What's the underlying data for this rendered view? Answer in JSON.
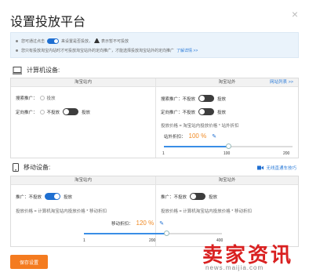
{
  "dialog": {
    "title": "设置投放平台",
    "close_label": "×"
  },
  "notice": {
    "line1_before": "您可通过点击",
    "line1_after": "来设置是否投放，",
    "line1_tail": "表示暂不可投放",
    "line2": "您只有投放淘宝内站时才可投放淘宝站外的定向推广，才能选择投放淘宝站外的定向推广",
    "line2_link": "了解详情 >>"
  },
  "computer": {
    "heading": "计算机设备:",
    "inside": {
      "header": "淘宝站内",
      "search_label": "搜索推广：",
      "search_value": "投放",
      "targeted_label": "定向推广：",
      "targeted_off": "不投放",
      "targeted_on": "投放"
    },
    "outside": {
      "header": "淘宝站外",
      "header_link": "网站列表 >>",
      "search_label": "搜索推广：",
      "search_off": "不投放",
      "search_on": "投放",
      "targeted_label": "定向推广：",
      "targeted_off": "不投放",
      "targeted_on": "投放",
      "price_formula": "投放价格 = 淘宝站内投放价格 * 站外折扣",
      "discount_label": "站外折扣：",
      "discount_value": "100 %",
      "slider_value": 0.5,
      "ticks": [
        "1",
        "100",
        "200"
      ]
    }
  },
  "mobile": {
    "heading": "移动设备:",
    "link": "无线直通车技巧",
    "inside": {
      "header": "淘宝站内",
      "promo_label": "推广：",
      "promo_off": "不投放",
      "promo_on": "投放",
      "price_formula": "投放价格 = 计算机淘宝站内投放价格 * 移动折扣"
    },
    "outside": {
      "header": "淘宝站外",
      "promo_label": "推广：",
      "promo_off": "不投放",
      "promo_on": "投放",
      "price_formula": "投放价格 = 计算机淘宝站内投放价格 * 移动折扣"
    },
    "discount_label": "移动折扣：",
    "discount_value": "120 %",
    "slider_value": 0.6,
    "ticks": [
      "1",
      "200",
      "400"
    ]
  },
  "actions": {
    "save_label": "保存设置"
  },
  "watermark": {
    "text": "卖家资讯",
    "url": "news.maijia.com"
  },
  "colors": {
    "accent": "#1f6fd1",
    "save": "#f47b20",
    "percent": "#f08a24",
    "watermark": "#d92020"
  }
}
